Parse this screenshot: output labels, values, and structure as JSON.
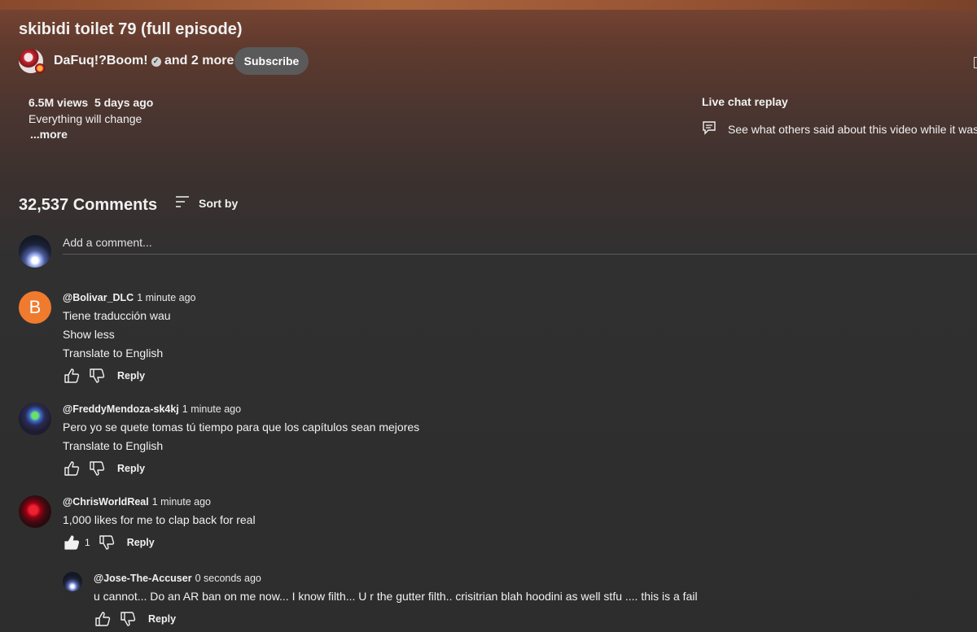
{
  "video": {
    "title": "skibidi toilet 79 (full episode)",
    "channel_name": "DaFuq!?Boom!",
    "collab_text": "and 2 more",
    "subscribe_label": "Subscribe",
    "views": "6.5M views",
    "age": "5 days ago",
    "description": "Everything will change",
    "more_label": "...more"
  },
  "live_chat": {
    "title": "Live chat replay",
    "text": "See what others said about this video while it was l"
  },
  "comments_section": {
    "count_label": "32,537 Comments",
    "sort_label": "Sort by",
    "add_placeholder": "Add a comment..."
  },
  "comments": [
    {
      "author": "@Bolivar_DLC",
      "time": "1 minute ago",
      "avatar_letter": "B",
      "text": "Tiene traducción wau",
      "show_less": "Show less",
      "translate": "Translate to English",
      "reply_label": "Reply"
    },
    {
      "author": "@FreddyMendoza-sk4kj",
      "time": "1 minute ago",
      "text": "Pero yo se quete tomas tú tiempo para que los capítulos sean mejores",
      "translate": "Translate to English",
      "reply_label": "Reply"
    },
    {
      "author": "@ChrisWorldReal",
      "time": "1 minute ago",
      "text": "1,000 likes for me to clap back for real",
      "like_count": "1",
      "reply_label": "Reply"
    }
  ],
  "reply": {
    "author": "@Jose-The-Accuser",
    "time": "0 seconds ago",
    "text": "u cannot... Do an AR ban on me now... I know filth... U r the gutter filth.. crisitrian blah hoodini as well stfu .... this is a fail",
    "reply_label": "Reply"
  },
  "colors": {
    "subscribe_bg": "#5a5a5a",
    "avatar_b": "#f07a2e",
    "page_bg": "#2d2d2d"
  }
}
